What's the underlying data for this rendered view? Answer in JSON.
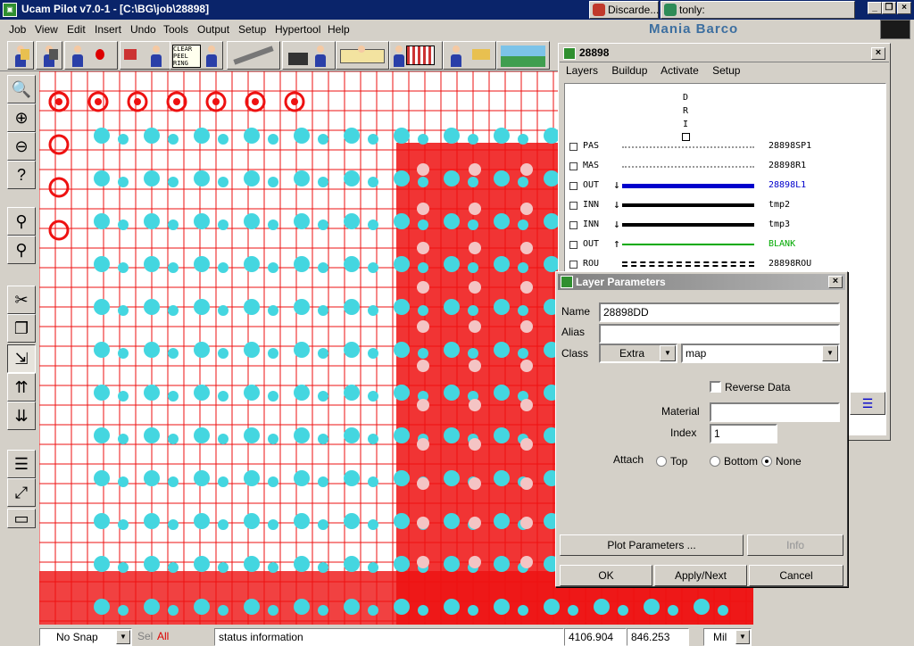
{
  "window": {
    "title": "Ucam Pilot v7.0-1 - [C:\\BG\\job\\28898]",
    "app_icon": "ucam-icon"
  },
  "taskbar": {
    "items": [
      {
        "label": "Discarde...",
        "icon": "discard-icon",
        "color": "#c0392b"
      },
      {
        "label": "tonly:",
        "icon": "mail-icon",
        "color": "#2e8b57"
      }
    ],
    "controls": [
      "_",
      "□",
      "×"
    ]
  },
  "menu": {
    "items": [
      {
        "label": "Job"
      },
      {
        "label": "View"
      },
      {
        "label": "Edit"
      },
      {
        "label": "Insert"
      },
      {
        "label": "Undo"
      },
      {
        "label": "Tools"
      },
      {
        "label": "Output"
      },
      {
        "label": "Setup"
      },
      {
        "label": "Hypertool"
      },
      {
        "label": "Help"
      }
    ],
    "brand": "Mania Barco"
  },
  "toolbar": {
    "buttons": [
      {
        "icon": "operator-icon"
      },
      {
        "icon": "operator-drill-icon"
      },
      {
        "icon": "operator-stop-icon"
      },
      {
        "icon": "operator-chart-icon"
      },
      {
        "icon": "clear-peel-ring-icon",
        "label": "CLEAR PEEL RING"
      },
      {
        "icon": "tools-wrench-icon"
      },
      {
        "icon": "camera-icon"
      },
      {
        "icon": "panel-icon"
      },
      {
        "icon": "grid-layout-icon"
      },
      {
        "icon": "operator-gun-icon"
      },
      {
        "icon": "landscape-icon"
      }
    ]
  },
  "left_tools": [
    {
      "icon": "zoom-icon"
    },
    {
      "icon": "zoom-in-icon"
    },
    {
      "icon": "zoom-out-icon"
    },
    {
      "icon": "zoom-query-icon"
    },
    {
      "icon": "dimension-person-icon"
    },
    {
      "icon": "layer-person-icon"
    },
    {
      "icon": "scissors-icon"
    },
    {
      "icon": "copy-icon"
    },
    {
      "icon": "move-icon"
    },
    {
      "icon": "align-icon"
    },
    {
      "icon": "distribute-icon"
    },
    {
      "icon": "properties-icon"
    },
    {
      "icon": "transform-icon"
    },
    {
      "icon": "ruler-icon"
    }
  ],
  "statusbar": {
    "snap": "No Snap",
    "sel_label": "Sel",
    "sel_value": "All",
    "status": "status information",
    "x": "4106.904",
    "y": "846.253",
    "unit": "Mil"
  },
  "layers_window": {
    "title": "28898",
    "menu": [
      "Layers",
      "Buildup",
      "Activate",
      "Setup"
    ],
    "dri": [
      "D",
      "R",
      "I"
    ],
    "rows": [
      {
        "type": "PAS",
        "arrow": "",
        "name": "28898SP1",
        "style": "dotted",
        "color": "#000000"
      },
      {
        "type": "MAS",
        "arrow": "",
        "name": "28898R1",
        "style": "dotted",
        "color": "#000000"
      },
      {
        "type": "OUT",
        "arrow": "↓",
        "name": "28898L1",
        "style": "blue",
        "color": "#0000cc"
      },
      {
        "type": "INN",
        "arrow": "↓",
        "name": "tmp2",
        "style": "black",
        "color": "#000000"
      },
      {
        "type": "INN",
        "arrow": "↓",
        "name": "tmp3",
        "style": "black",
        "color": "#000000"
      },
      {
        "type": "OUT",
        "arrow": "↑",
        "name": "BLANK",
        "style": "green",
        "color": "#00aa00"
      },
      {
        "type": "ROU",
        "arrow": "",
        "name": "28898ROU",
        "style": "double",
        "color": "#000000"
      }
    ]
  },
  "layer_params": {
    "title": "Layer Parameters",
    "name_label": "Name",
    "name_value": "28898DD",
    "alias_label": "Alias",
    "alias_value": "",
    "class_label": "Class",
    "class_value": "Extra",
    "class_map": "map",
    "reverse_label": "Reverse Data",
    "material_label": "Material",
    "material_value": "",
    "index_label": "Index",
    "index_value": "1",
    "attach_label": "Attach",
    "attach_top": "Top",
    "attach_bottom": "Bottom",
    "attach_none": "None",
    "plot_params_btn": "Plot Parameters ...",
    "info_btn": "Info",
    "ok_btn": "OK",
    "apply_next_btn": "Apply/Next",
    "cancel_btn": "Cancel"
  }
}
